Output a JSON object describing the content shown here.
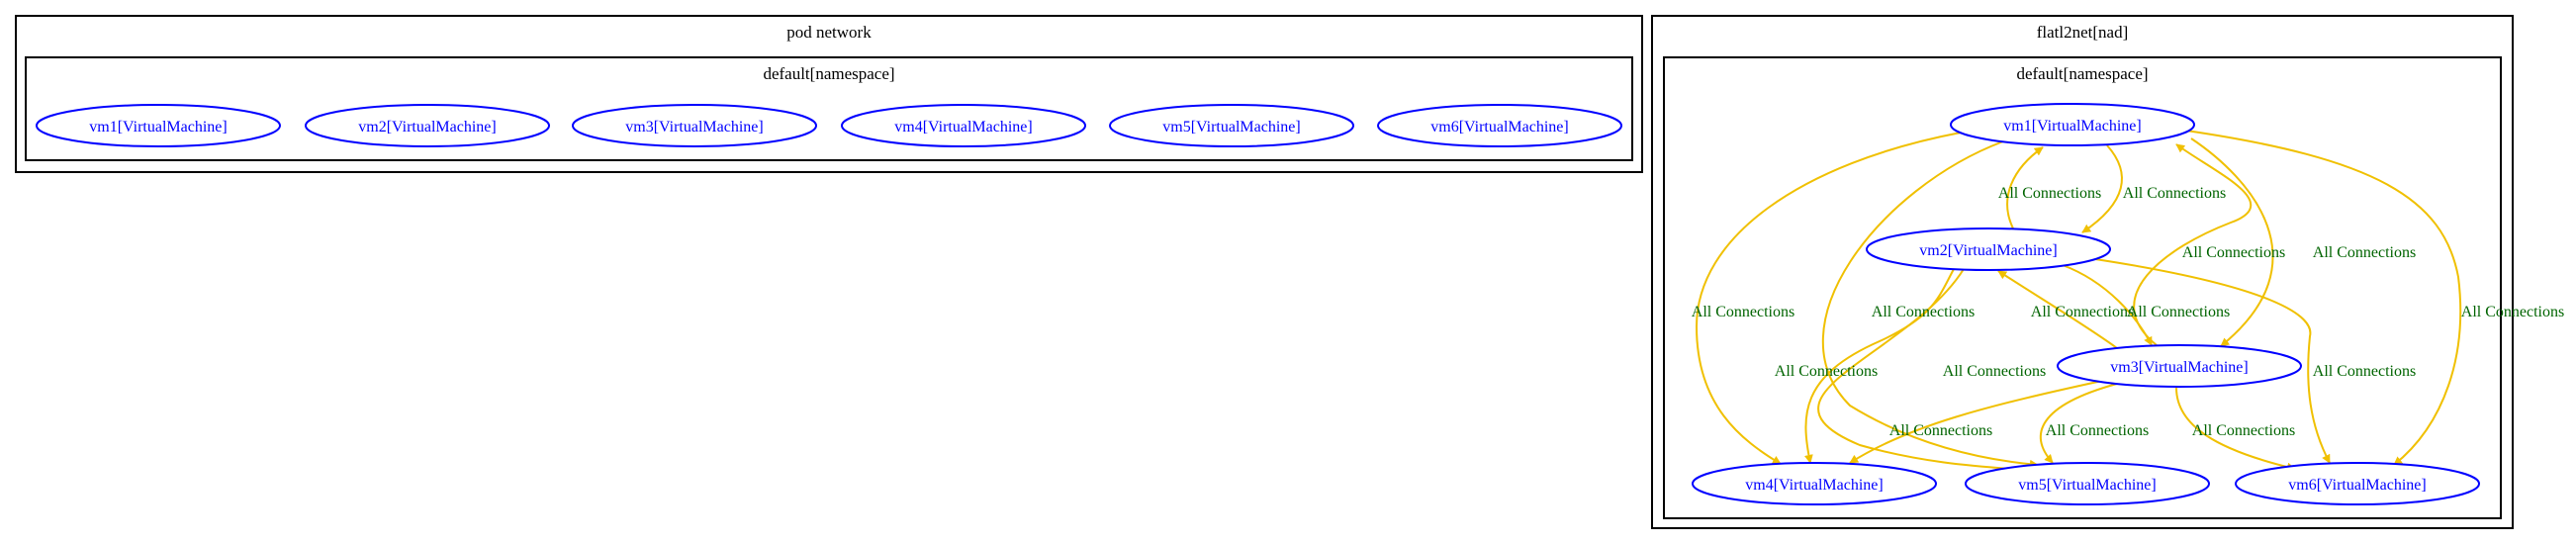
{
  "colors": {
    "cluster_border": "#000000",
    "node_border": "#0000ff",
    "node_text": "#0000ff",
    "edge": "#f0c000",
    "edge_label": "#006400"
  },
  "pod_network": {
    "title": "pod network",
    "namespace_title": "default[namespace]",
    "nodes": [
      "vm1[VirtualMachine]",
      "vm2[VirtualMachine]",
      "vm3[VirtualMachine]",
      "vm4[VirtualMachine]",
      "vm5[VirtualMachine]",
      "vm6[VirtualMachine]"
    ]
  },
  "flatl2net": {
    "title": "flatl2net[nad]",
    "namespace_title": "default[namespace]",
    "nodes": {
      "vm1": "vm1[VirtualMachine]",
      "vm2": "vm2[VirtualMachine]",
      "vm3": "vm3[VirtualMachine]",
      "vm4": "vm4[VirtualMachine]",
      "vm5": "vm5[VirtualMachine]",
      "vm6": "vm6[VirtualMachine]"
    },
    "edges": [
      {
        "from": "vm2",
        "to": "vm1",
        "label": "All Connections"
      },
      {
        "from": "vm1",
        "to": "vm2",
        "label": "All Connections"
      },
      {
        "from": "vm3",
        "to": "vm1",
        "label": "All Connections"
      },
      {
        "from": "vm1",
        "to": "vm3",
        "label": "All Connections"
      },
      {
        "from": "vm1",
        "to": "vm4",
        "label": "All Connections"
      },
      {
        "from": "vm1",
        "to": "vm5",
        "label": "All Connections"
      },
      {
        "from": "vm1",
        "to": "vm6",
        "label": "All Connections"
      },
      {
        "from": "vm2",
        "to": "vm3",
        "label": "All Connections"
      },
      {
        "from": "vm3",
        "to": "vm2",
        "label": "All Connections"
      },
      {
        "from": "vm2",
        "to": "vm4",
        "label": "All Connections"
      },
      {
        "from": "vm2",
        "to": "vm5",
        "label": "All Connections"
      },
      {
        "from": "vm2",
        "to": "vm6",
        "label": "All Connections"
      },
      {
        "from": "vm3",
        "to": "vm4",
        "label": "All Connections"
      },
      {
        "from": "vm3",
        "to": "vm5",
        "label": "All Connections"
      },
      {
        "from": "vm3",
        "to": "vm6",
        "label": "All Connections"
      }
    ]
  }
}
